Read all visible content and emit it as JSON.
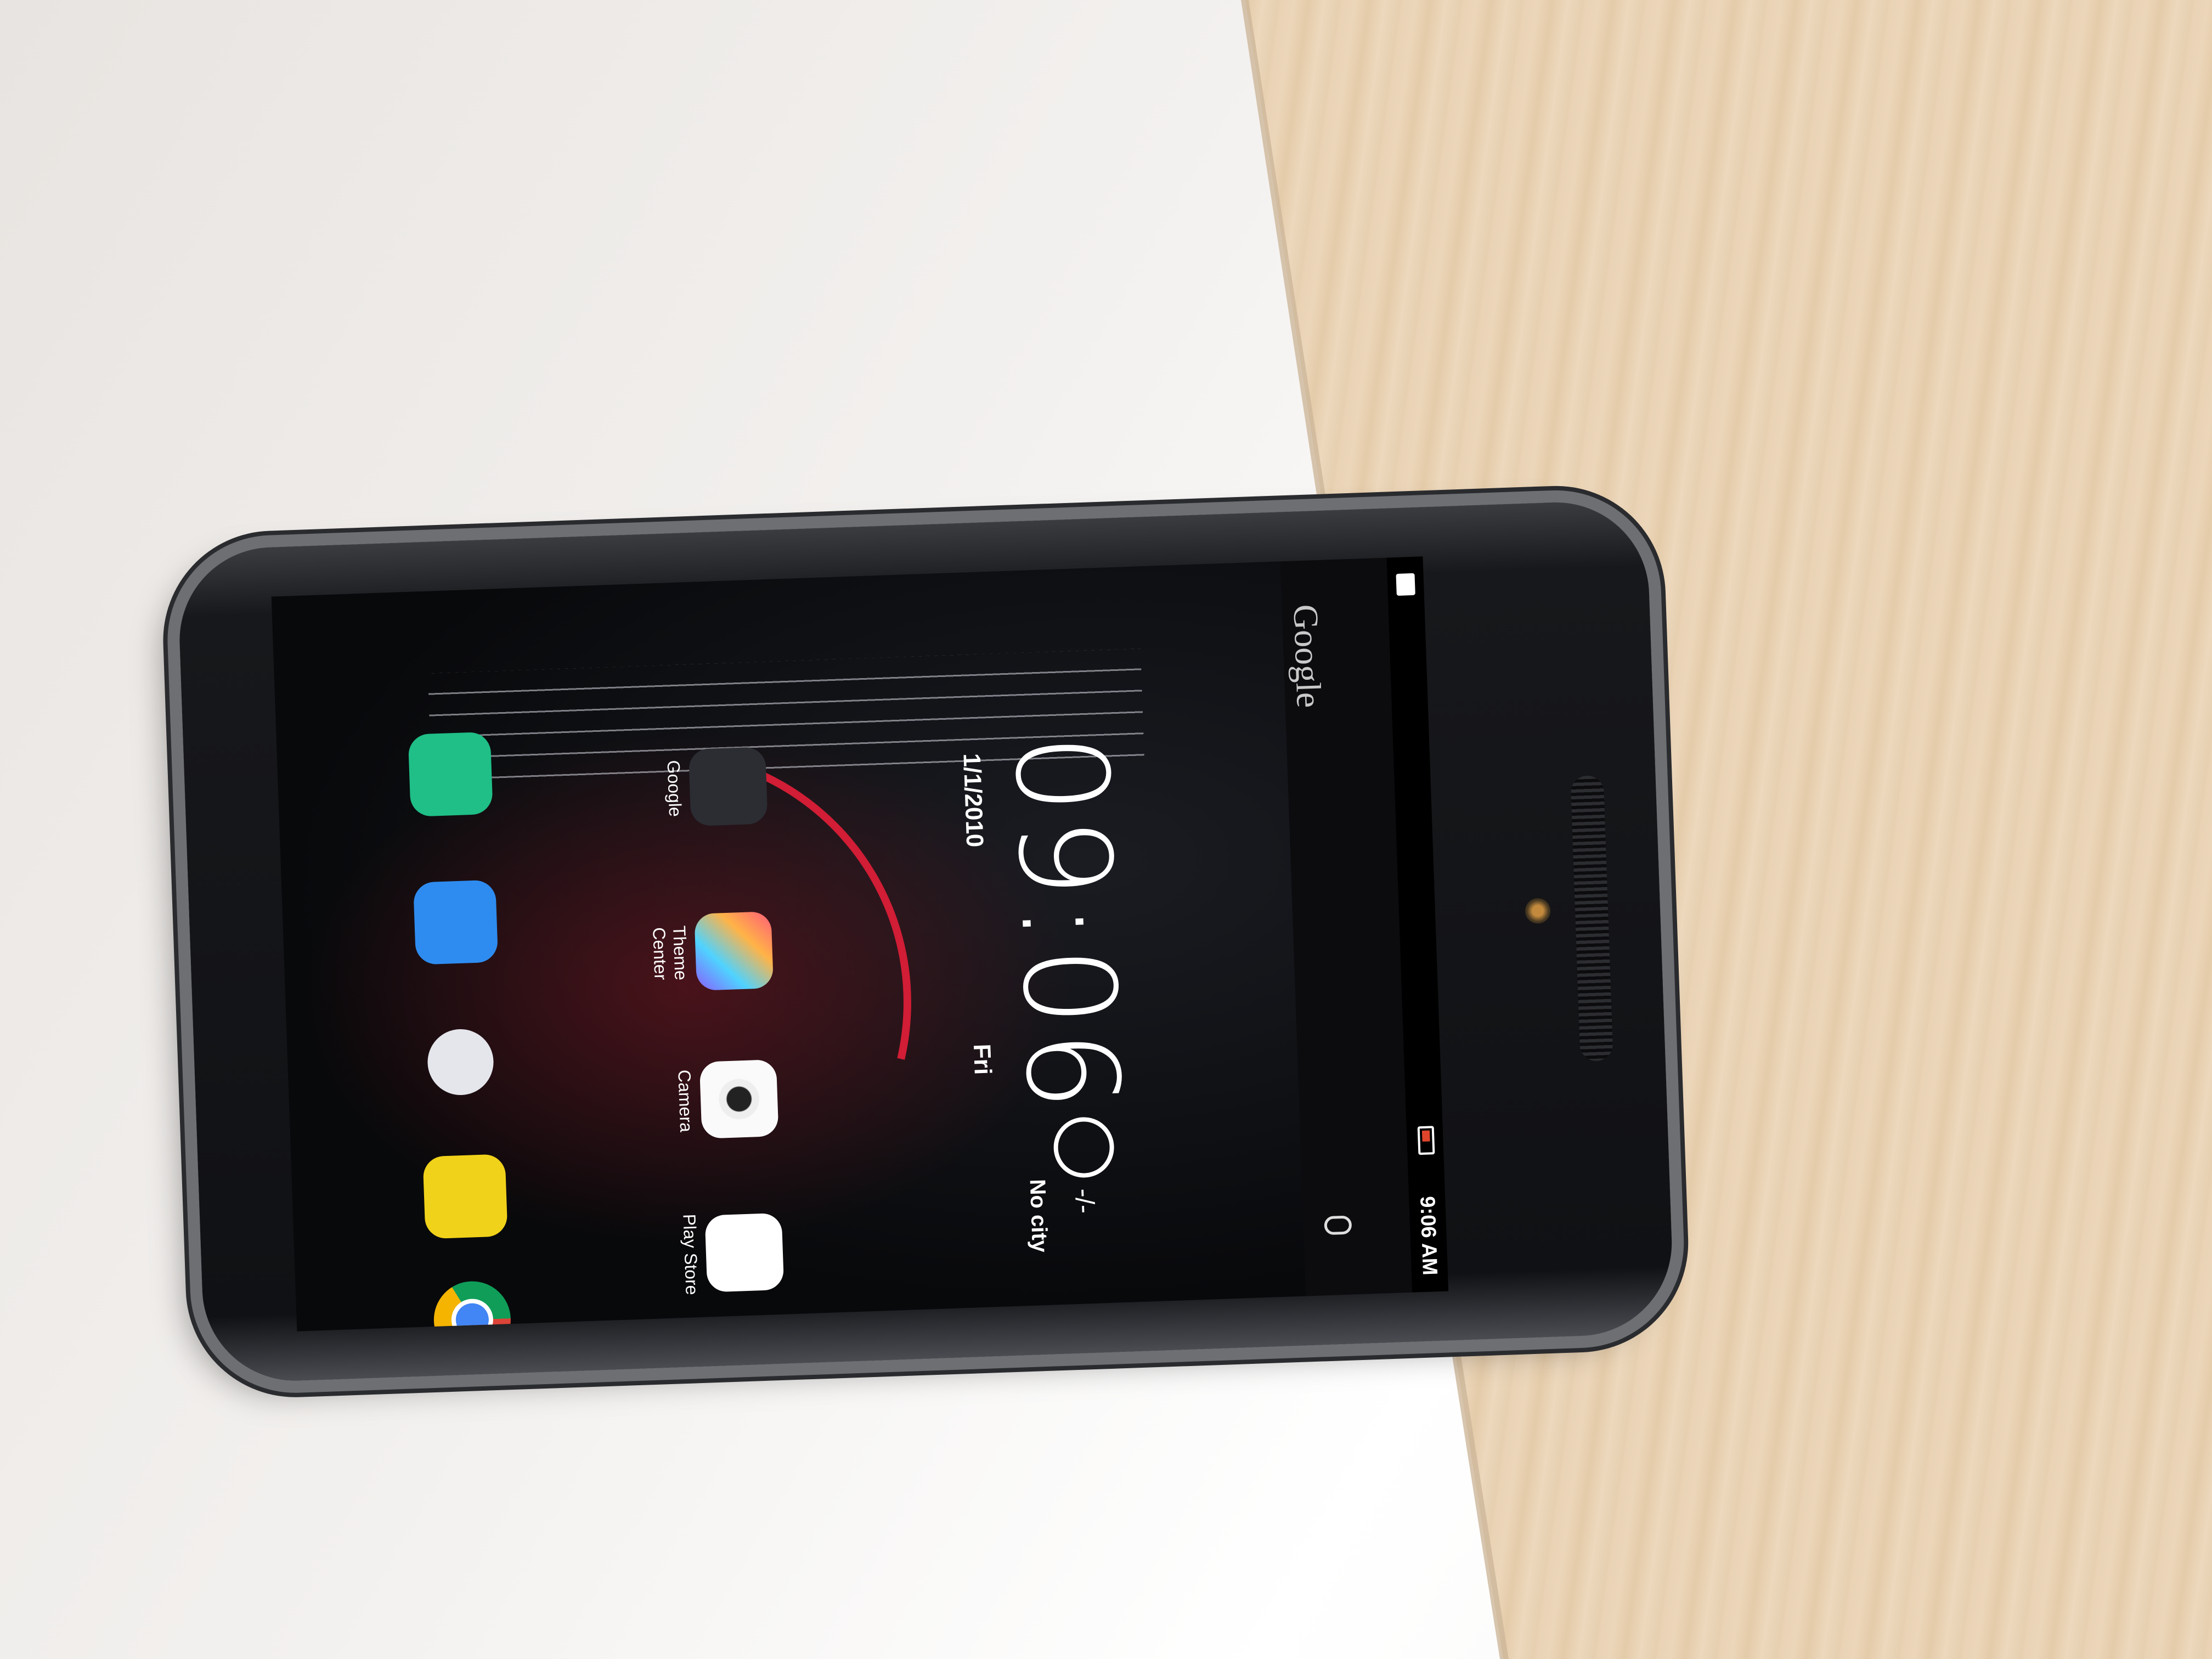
{
  "status_bar": {
    "time": "9:06 AM"
  },
  "search": {
    "logo": "Google"
  },
  "clock": {
    "time": "09:06",
    "date": "1/1/2010",
    "day": "Fri"
  },
  "weather": {
    "temp": "-/-",
    "city": "No city"
  },
  "apps": {
    "play_store": "Play Store",
    "camera": "Camera",
    "theme_center": "Theme Center",
    "google": "Google"
  }
}
